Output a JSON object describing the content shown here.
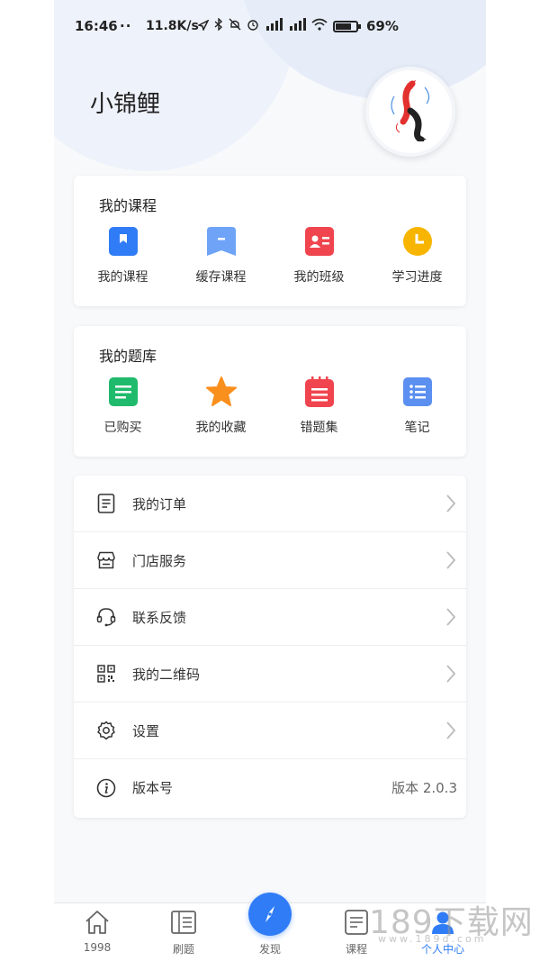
{
  "status_bar": {
    "time": "16:46",
    "dots": "··",
    "net_speed": "11.8K/s",
    "battery_pct": "69%"
  },
  "profile": {
    "username": "小锦鲤",
    "avatar_icon": "koi-fish-icon"
  },
  "courses_card": {
    "title": "我的课程",
    "items": [
      {
        "label": "我的课程",
        "icon": "bookmark-icon",
        "color": "#2f7cf6"
      },
      {
        "label": "缓存课程",
        "icon": "cache-icon",
        "color": "#6ea3f7"
      },
      {
        "label": "我的班级",
        "icon": "id-card-icon",
        "color": "#f0454f"
      },
      {
        "label": "学习进度",
        "icon": "clock-icon",
        "color": "#f7b500"
      }
    ]
  },
  "questions_card": {
    "title": "我的题库",
    "items": [
      {
        "label": "已购买",
        "icon": "document-icon",
        "color": "#1fba6b"
      },
      {
        "label": "我的收藏",
        "icon": "star-icon",
        "color": "#f98f1d"
      },
      {
        "label": "错题集",
        "icon": "notebook-icon",
        "color": "#f0454f"
      },
      {
        "label": "笔记",
        "icon": "list-icon",
        "color": "#5b8ff0"
      }
    ]
  },
  "menu": [
    {
      "label": "我的订单",
      "icon": "order-icon"
    },
    {
      "label": "门店服务",
      "icon": "store-icon"
    },
    {
      "label": "联系反馈",
      "icon": "headset-icon"
    },
    {
      "label": "我的二维码",
      "icon": "qr-code-icon"
    },
    {
      "label": "设置",
      "icon": "gear-icon"
    },
    {
      "label": "版本号",
      "icon": "info-icon",
      "value": "版本 2.0.3"
    }
  ],
  "tabbar": [
    {
      "label": "1998",
      "icon": "home-icon"
    },
    {
      "label": "刷题",
      "icon": "question-bank-icon"
    },
    {
      "label": "发现",
      "icon": "compass-icon"
    },
    {
      "label": "课程",
      "icon": "course-icon"
    },
    {
      "label": "个人中心",
      "icon": "person-icon"
    }
  ],
  "watermark": {
    "text": "189下载网",
    "sub": "www.189d.com"
  },
  "colors": {
    "accent": "#2f7cf6",
    "background": "#f8f9fb"
  }
}
